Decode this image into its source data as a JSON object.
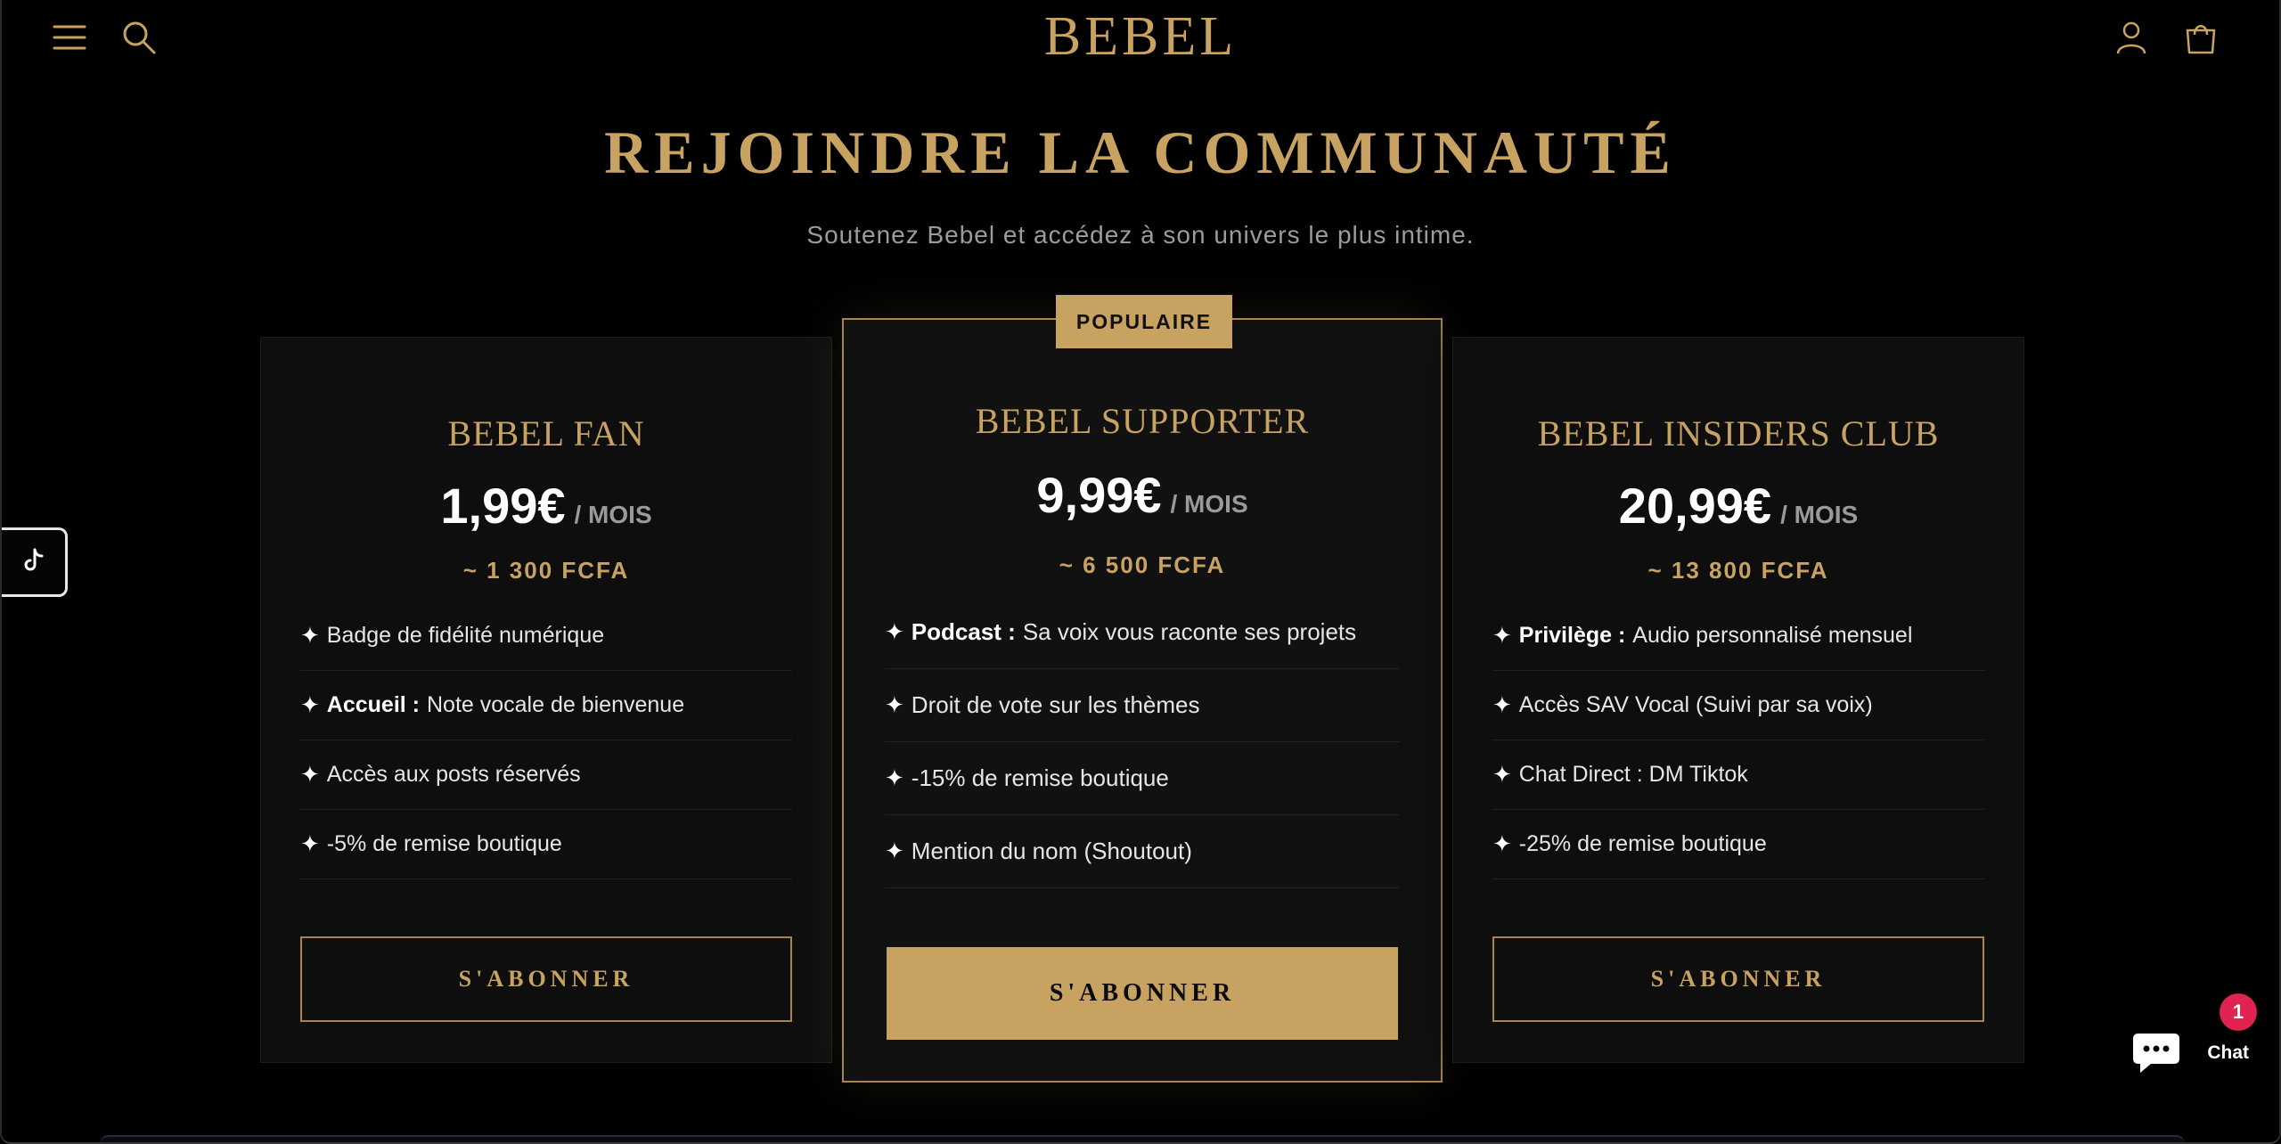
{
  "header": {
    "logo": "BEBEL",
    "icons": [
      "menu-icon",
      "search-icon",
      "account-icon",
      "cart-icon"
    ]
  },
  "hero": {
    "title": "REJOINDRE LA COMMUNAUTÉ",
    "subtitle": "Soutenez Bebel et accédez à son univers le plus intime."
  },
  "plans": [
    {
      "name": "BEBEL FAN",
      "price": "1,99€",
      "period": "/ MOIS",
      "fcfa": "~ 1 300 FCFA",
      "features": [
        {
          "bold": "",
          "text": "Badge de fidélité numérique"
        },
        {
          "bold": "Accueil :",
          "text": "Note vocale de bienvenue"
        },
        {
          "bold": "",
          "text": "Accès aux posts réservés"
        },
        {
          "bold": "",
          "text": "-5% de remise boutique"
        }
      ],
      "button": "S'ABONNER"
    },
    {
      "badge": "POPULAIRE",
      "name": "BEBEL SUPPORTER",
      "price": "9,99€",
      "period": "/ MOIS",
      "fcfa": "~ 6 500 FCFA",
      "features": [
        {
          "bold": "Podcast :",
          "text": "Sa voix vous raconte ses projets"
        },
        {
          "bold": "",
          "text": "Droit de vote sur les thèmes"
        },
        {
          "bold": "",
          "text": "-15% de remise boutique"
        },
        {
          "bold": "",
          "text": "Mention du nom (Shoutout)"
        }
      ],
      "button": "S'ABONNER"
    },
    {
      "name": "BEBEL INSIDERS CLUB",
      "price": "20,99€",
      "period": "/ MOIS",
      "fcfa": "~ 13 800 FCFA",
      "features": [
        {
          "bold": "Privilège :",
          "text": "Audio personnalisé mensuel"
        },
        {
          "bold": "",
          "text": "Accès SAV Vocal (Suivi par sa voix)"
        },
        {
          "bold": "",
          "text": "Chat Direct : DM Tiktok"
        },
        {
          "bold": "",
          "text": "-25% de remise boutique"
        }
      ],
      "button": "S'ABONNER"
    }
  ],
  "feature_marker": "✦",
  "chat": {
    "label": "Chat",
    "count": "1"
  },
  "colors": {
    "accent": "#c8a261",
    "background": "#000000",
    "card": "#0e0e0e",
    "notification": "#e0244f"
  }
}
